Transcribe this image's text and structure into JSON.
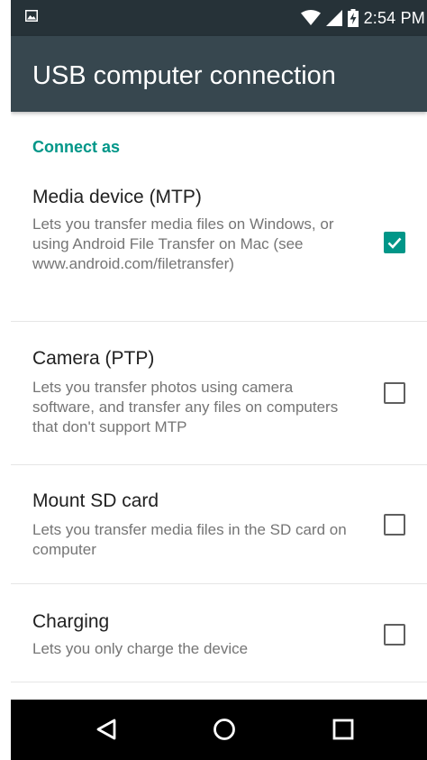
{
  "status_bar": {
    "time": "2:54 PM",
    "icons": [
      "image-notification-icon",
      "wifi-icon",
      "signal-icon",
      "battery-charging-icon"
    ]
  },
  "app_bar": {
    "title": "USB computer connection"
  },
  "section": {
    "header": "Connect as"
  },
  "options": [
    {
      "title": "Media device (MTP)",
      "description": "Lets you transfer media files on Windows, or using Android File Transfer on Mac (see www.android.com/filetransfer)",
      "checked": true
    },
    {
      "title": "Camera (PTP)",
      "description": "Lets you transfer photos using camera software, and transfer any files on computers that don't support MTP",
      "checked": false
    },
    {
      "title": "Mount SD card",
      "description": "Lets you transfer media files in the SD card on computer",
      "checked": false
    },
    {
      "title": "Charging",
      "description": "Lets you only charge the device",
      "checked": false
    }
  ],
  "nav_bar": {
    "icons": [
      "back-icon",
      "home-icon",
      "recents-icon"
    ]
  },
  "colors": {
    "status_bar": "#263238",
    "app_bar": "#37474f",
    "accent": "#009688",
    "nav_bar": "#000000"
  }
}
